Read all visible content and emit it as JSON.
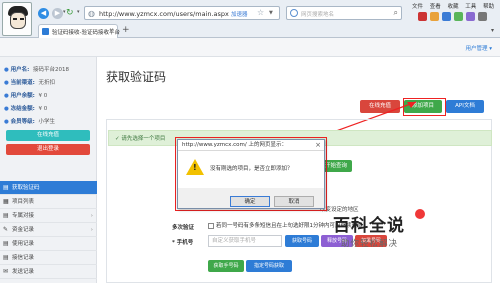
{
  "browser": {
    "url": "http://www.yzmcx.com/users/main.aspx",
    "mode_label": "加速器",
    "search_placeholder": "网页搜索地名",
    "menus": [
      "文件",
      "查看",
      "收藏",
      "工具",
      "帮助"
    ],
    "tab_title": "验证码接收-验证码接收平台"
  },
  "topbar": {
    "user_menu": "用户管理 ▾"
  },
  "sidebar": {
    "info": [
      {
        "key": "用户名:",
        "value": "接码平台2018"
      },
      {
        "key": "当前渠道:",
        "value": "无折扣"
      },
      {
        "key": "用户余额:",
        "value": "¥ 0"
      },
      {
        "key": "冻结金额:",
        "value": "¥ 0"
      },
      {
        "key": "会员等级:",
        "value": "小学生"
      }
    ],
    "btn_online": "在线充值",
    "btn_logout": "退出登录",
    "menu": [
      {
        "label": "获取验证码",
        "active": true
      },
      {
        "label": "项目列表",
        "active": false
      },
      {
        "label": "专属对接",
        "active": false
      },
      {
        "label": "资金记录",
        "active": false
      },
      {
        "label": "使用记录",
        "active": false
      },
      {
        "label": "接信记录",
        "active": false
      },
      {
        "label": "发送记录",
        "active": false
      }
    ]
  },
  "main": {
    "title": "获取验证码",
    "btn_online": "在线充值",
    "btn_add": "添加项目",
    "btn_api": "API文档",
    "alert": "请先选择一个项目",
    "btn_start": "开始查询",
    "multi_label": "多次验证",
    "hint_text": "改变设定的地区",
    "checkbox_text": "若同一号码有多条短信且在上句选好限1分钟内可用继续获取",
    "phone_label": "手机号",
    "phone_placeholder": "自定义获取手机号",
    "btn_get_number": "获取号码",
    "btn_release": "释放号码",
    "btn_blacklist": "加黑号码",
    "btn_get_sms": "获取手号码",
    "btn_get_code": "指定号码获取"
  },
  "dialog": {
    "title": "http://www.yzmcx.com/ 上的网页显示：",
    "message": "没有刚选的项目，是否立即添加？",
    "ok": "确定",
    "cancel": "取消"
  },
  "watermark": {
    "logo": "百科全说",
    "sub": "助你轻松解决"
  }
}
